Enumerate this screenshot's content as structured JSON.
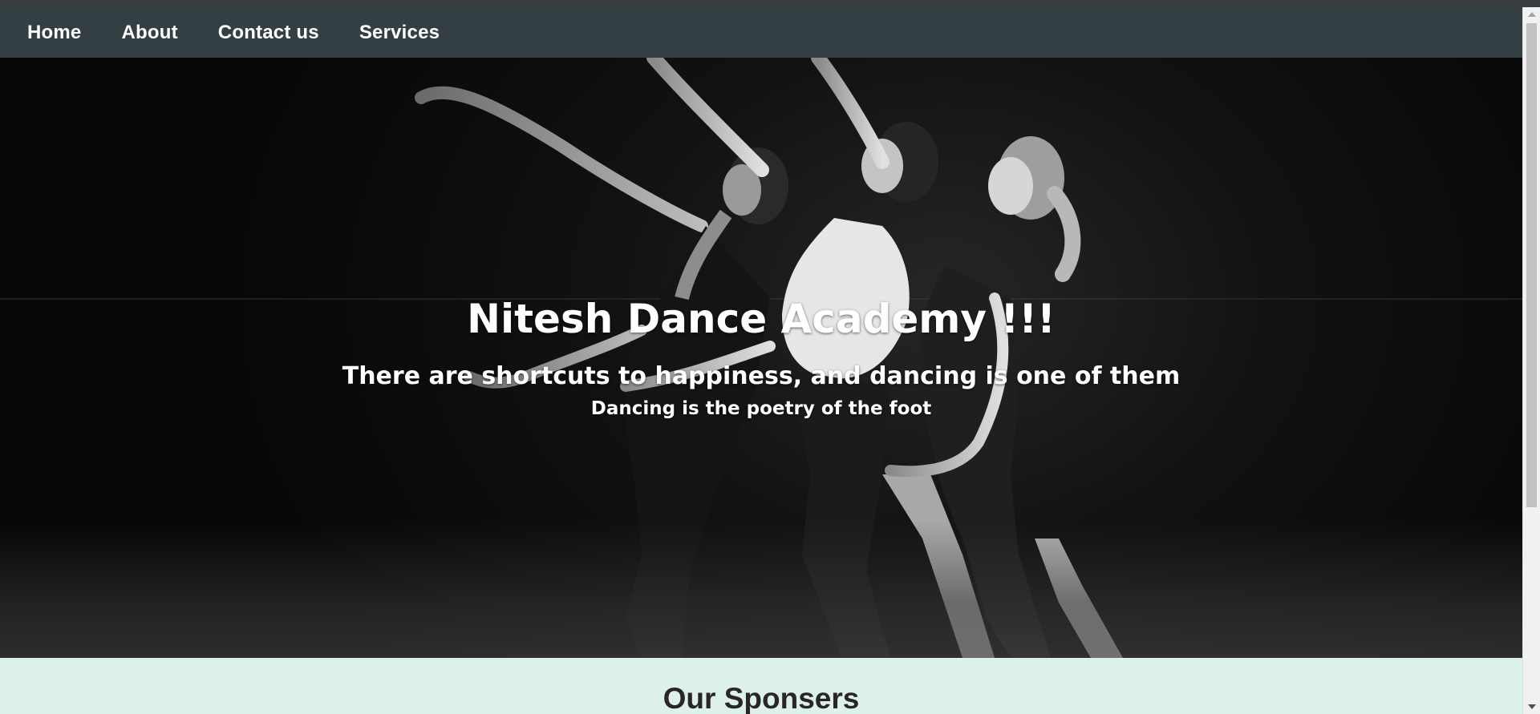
{
  "nav": {
    "items": [
      {
        "label": "Home"
      },
      {
        "label": "About"
      },
      {
        "label": "Contact us"
      },
      {
        "label": "Services"
      }
    ]
  },
  "hero": {
    "title": "Nitesh Dance Academy !!!",
    "subtitle": "There are shortcuts to happiness, and dancing is one of them",
    "tagline": "Dancing is the poetry of the foot",
    "image": "ballet-dancers-photo"
  },
  "sponsors": {
    "heading": "Our Sponsers"
  },
  "colors": {
    "navbar_bg": "#343f44",
    "nav_text": "#ffffff",
    "hero_text": "#ffffff",
    "sponsors_bg": "#dcf1ea",
    "sponsors_heading": "#2b2626"
  }
}
